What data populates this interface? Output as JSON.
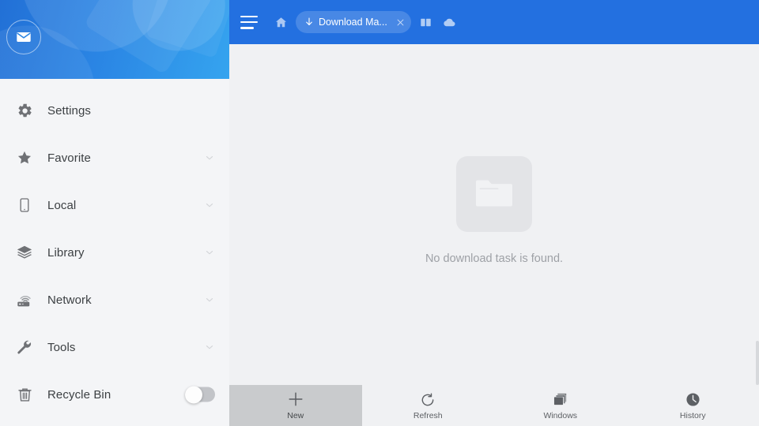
{
  "app": {
    "title": "Download Manager"
  },
  "colors": {
    "header_blue": "#2370e0",
    "sidebar_gradient_start": "#2270d6",
    "sidebar_gradient_end": "#35a4ef",
    "sidebar_bg": "#f4f5f7",
    "content_bg": "#f0f1f3",
    "active_tab_bg": "#c9cbcd",
    "text_primary": "#3c4043",
    "text_muted": "#9ea1a6"
  },
  "sidebar": {
    "avatar_icon": "mail-icon",
    "items": [
      {
        "label": "Settings",
        "icon": "gear-icon",
        "chevron": false,
        "toggle": false
      },
      {
        "label": "Favorite",
        "icon": "star-icon",
        "chevron": true,
        "toggle": false
      },
      {
        "label": "Local",
        "icon": "phone-icon",
        "chevron": true,
        "toggle": false
      },
      {
        "label": "Library",
        "icon": "layers-icon",
        "chevron": true,
        "toggle": false
      },
      {
        "label": "Network",
        "icon": "router-icon",
        "chevron": true,
        "toggle": false
      },
      {
        "label": "Tools",
        "icon": "wrench-icon",
        "chevron": true,
        "toggle": false
      },
      {
        "label": "Recycle Bin",
        "icon": "trash-icon",
        "chevron": false,
        "toggle": true,
        "toggle_state": "off"
      }
    ]
  },
  "topbar": {
    "menu_icon": "hamburger-menu-icon",
    "home_icon": "home-icon",
    "tab": {
      "icon": "download-arrow-icon",
      "title": "Download Ma...",
      "close_icon": "close-icon"
    },
    "right_icons": [
      {
        "name": "windows-split-icon"
      },
      {
        "name": "cloud-icon"
      }
    ]
  },
  "main": {
    "empty_state": {
      "icon": "folder-icon",
      "message": "No download task is found."
    }
  },
  "bottombar": {
    "buttons": [
      {
        "label": "New",
        "icon": "plus-icon",
        "active": true
      },
      {
        "label": "Refresh",
        "icon": "refresh-icon",
        "active": false
      },
      {
        "label": "Windows",
        "icon": "windows-icon",
        "active": false
      },
      {
        "label": "History",
        "icon": "clock-icon",
        "active": false
      }
    ]
  }
}
